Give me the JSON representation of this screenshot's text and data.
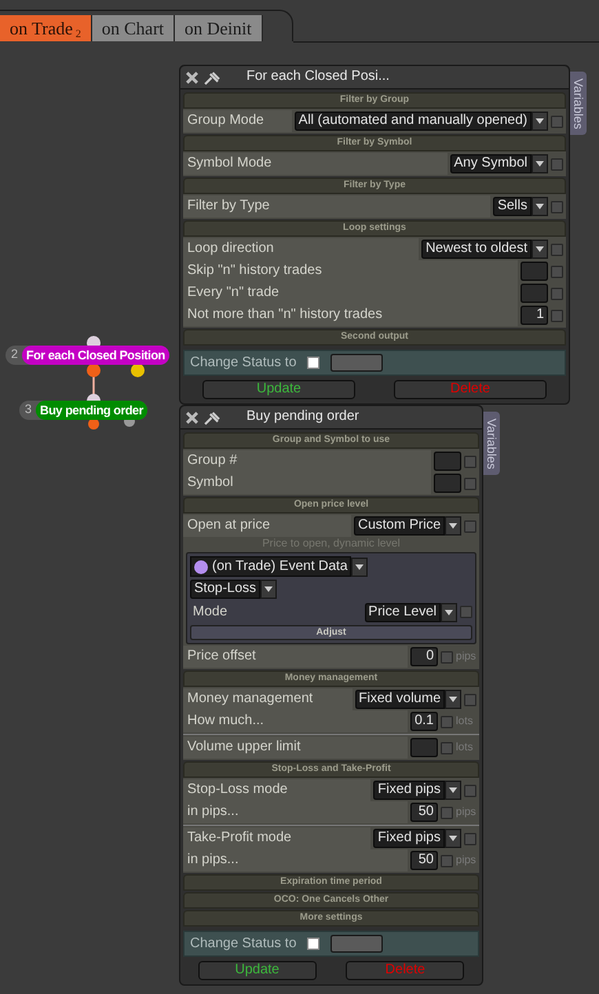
{
  "tabs": [
    {
      "label": "on Trade",
      "badge": "2",
      "selected": true
    },
    {
      "label": "on Chart",
      "selected": false
    },
    {
      "label": "on Deinit",
      "selected": false
    }
  ],
  "nodes": [
    {
      "number": "2",
      "label": "For each Closed Position",
      "color": "#c400c4"
    },
    {
      "number": "3",
      "label": "Buy pending order",
      "color": "#008c00"
    }
  ],
  "panels": [
    {
      "title": "For each Closed Posi...",
      "side_tab": "Variables",
      "sections": [
        {
          "header": "Filter by Group",
          "groups": [
            [
              {
                "kind": "select",
                "label": "Group Mode",
                "value": "All (automated and manually opened)",
                "checked": false
              }
            ]
          ]
        },
        {
          "header": "Filter by Symbol",
          "groups": [
            [
              {
                "kind": "select",
                "label": "Symbol Mode",
                "value": "Any Symbol",
                "checked": false
              }
            ]
          ]
        },
        {
          "header": "Filter by Type",
          "groups": [
            [
              {
                "kind": "select",
                "label": "Filter by Type",
                "value": "Sells",
                "checked": false
              }
            ]
          ]
        },
        {
          "header": "Loop settings",
          "groups": [
            [
              {
                "kind": "select",
                "label": "Loop direction",
                "value": "Newest to oldest",
                "checked": false
              },
              {
                "kind": "input",
                "label": "Skip \"n\" history trades",
                "checked": false
              },
              {
                "kind": "input",
                "label": "Every \"n\" trade",
                "checked": false
              },
              {
                "kind": "input",
                "label": "Not more than \"n\" history trades",
                "value": "1",
                "checked": false
              }
            ]
          ]
        },
        {
          "header": "Second output"
        }
      ],
      "status": {
        "label": "Change Status to",
        "checked": false
      },
      "buttons": [
        "Update",
        "Delete"
      ]
    },
    {
      "title": "Buy pending order",
      "side_tab": "Variables",
      "sections": [
        {
          "header": "Group and Symbol to use",
          "groups": [
            [
              {
                "kind": "input",
                "label": "Group #",
                "checked": false
              },
              {
                "kind": "input",
                "label": "Symbol",
                "checked": false
              }
            ]
          ]
        },
        {
          "header": "Open price level",
          "groups": [
            [
              {
                "kind": "select",
                "label": "Open at price",
                "value": "Custom Price",
                "checked": false
              },
              {
                "kind": "note",
                "text": "Price to open, dynamic level"
              },
              {
                "kind": "source",
                "value": "(on Trade) Event Data",
                "color": "#b48ef0",
                "subvalue": "Stop-Loss",
                "mode_label": "Mode",
                "mode_value": "Price Level",
                "checked": false,
                "button": "Adjust"
              },
              {
                "kind": "input",
                "label": "Price offset",
                "value": "0",
                "unit": "pips",
                "checked": false
              }
            ]
          ]
        },
        {
          "header": "Money management",
          "groups": [
            [
              {
                "kind": "select",
                "label": "Money management",
                "value": "Fixed volume",
                "checked": false
              },
              {
                "kind": "input",
                "label": "How much...",
                "value": "0.1",
                "unit": "lots",
                "checked": false
              }
            ],
            [
              {
                "kind": "input",
                "label": "Volume upper limit",
                "unit": "lots",
                "checked": false
              }
            ]
          ]
        },
        {
          "header": "Stop-Loss and Take-Profit",
          "groups": [
            [
              {
                "kind": "select",
                "label": "Stop-Loss mode",
                "value": "Fixed pips",
                "checked": false
              },
              {
                "kind": "input",
                "label": "in pips...",
                "value": "50",
                "unit": "pips",
                "checked": false
              }
            ],
            [
              {
                "kind": "select",
                "label": "Take-Profit mode",
                "value": "Fixed pips",
                "checked": false
              },
              {
                "kind": "input",
                "label": "in pips...",
                "value": "50",
                "unit": "pips",
                "checked": false
              }
            ]
          ]
        },
        {
          "header": "Expiration time period"
        },
        {
          "header": "OCO: One Cancels Other"
        },
        {
          "header": "More settings"
        }
      ],
      "status": {
        "label": "Change Status to",
        "checked": false
      },
      "buttons": [
        "Update",
        "Delete"
      ]
    }
  ]
}
